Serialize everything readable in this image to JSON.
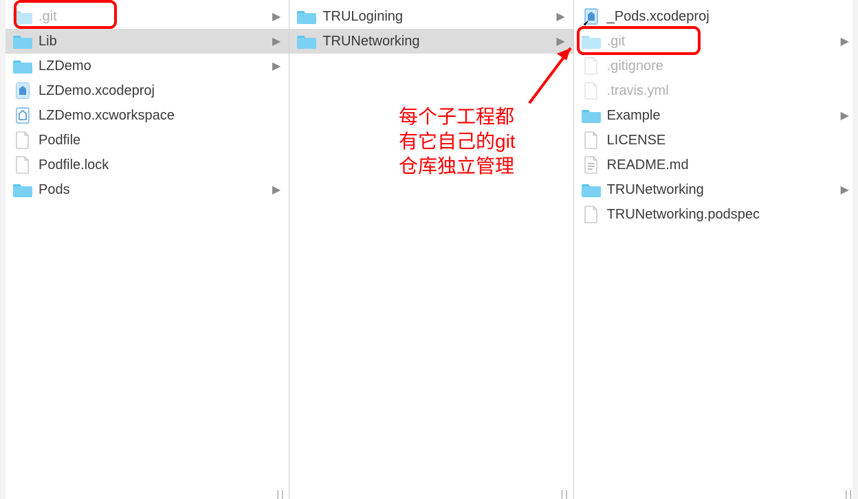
{
  "colors": {
    "highlight": "#ff0000",
    "folder": "#7ad1f4",
    "selected": "#dcdcdc"
  },
  "annotation": {
    "text": "每个子工程都\n有它自己的git\n仓库独立管理"
  },
  "columns": [
    {
      "items": [
        {
          "name": ".git",
          "kind": "folder",
          "expandable": true,
          "highlighted": true,
          "dim": true
        },
        {
          "name": "Lib",
          "kind": "folder",
          "expandable": true,
          "selected": true
        },
        {
          "name": "LZDemo",
          "kind": "folder",
          "expandable": true
        },
        {
          "name": "LZDemo.xcodeproj",
          "kind": "xcodeproj"
        },
        {
          "name": "LZDemo.xcworkspace",
          "kind": "xcworkspace"
        },
        {
          "name": "Podfile",
          "kind": "file"
        },
        {
          "name": "Podfile.lock",
          "kind": "file"
        },
        {
          "name": "Pods",
          "kind": "folder",
          "expandable": true
        }
      ]
    },
    {
      "items": [
        {
          "name": "TRULogining",
          "kind": "folder",
          "expandable": true
        },
        {
          "name": "TRUNetworking",
          "kind": "folder",
          "expandable": true,
          "selected": true
        }
      ]
    },
    {
      "items": [
        {
          "name": "_Pods.xcodeproj",
          "kind": "xcodeproj-alias"
        },
        {
          "name": ".git",
          "kind": "folder",
          "expandable": true,
          "highlighted": true,
          "dim": true
        },
        {
          "name": ".gitignore",
          "kind": "file",
          "dim": true
        },
        {
          "name": ".travis.yml",
          "kind": "file",
          "dim": true
        },
        {
          "name": "Example",
          "kind": "folder",
          "expandable": true
        },
        {
          "name": "LICENSE",
          "kind": "file"
        },
        {
          "name": "README.md",
          "kind": "textfile"
        },
        {
          "name": "TRUNetworking",
          "kind": "folder",
          "expandable": true
        },
        {
          "name": "TRUNetworking.podspec",
          "kind": "file"
        }
      ]
    }
  ]
}
